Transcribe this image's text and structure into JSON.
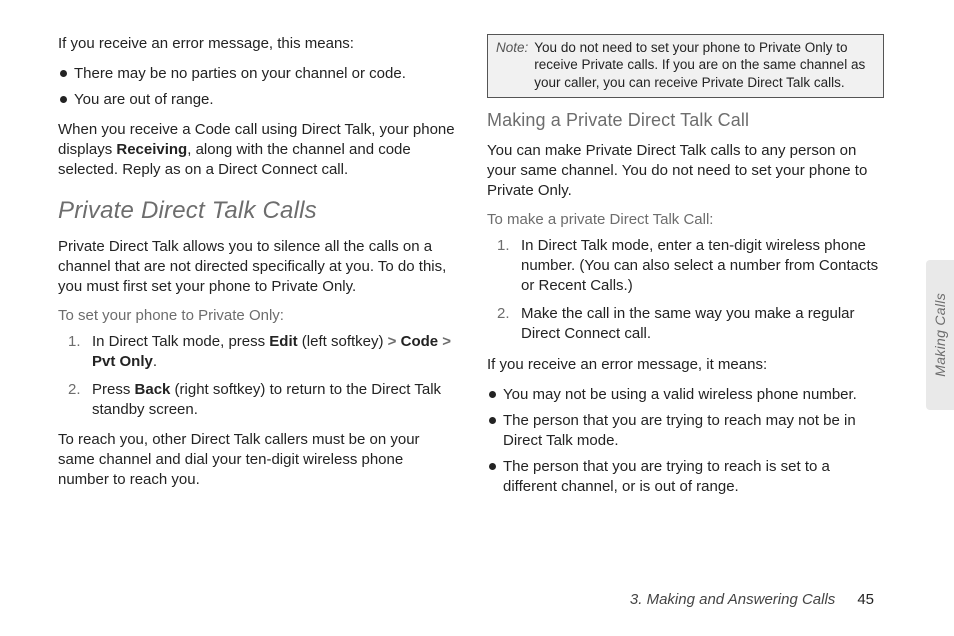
{
  "left": {
    "p1": "If you receive an error message, this means:",
    "bullets1": [
      "There may be no parties on your channel or code.",
      "You are out of range."
    ],
    "p2a": "When you receive a Code call using Direct Talk, your phone displays ",
    "p2bold": "Receiving",
    "p2b": ", along with the channel and code selected. Reply as on a Direct Connect call.",
    "h2": "Private Direct Talk Calls",
    "p3": "Private Direct Talk allows you to silence all the calls on a channel that are not directed specifically at you. To do this, you must first set your phone to Private Only.",
    "lead1": "To set your phone to Private Only:",
    "step1a": "In Direct Talk mode, press ",
    "step1b_bold": "Edit",
    "step1c": " (left softkey) ",
    "step1_gt1": ">",
    "step1d_bold": "Code",
    "step1_gt2": ">",
    "step1e_bold": "Pvt Only",
    "step1f": ".",
    "step2a": "Press ",
    "step2b_bold": "Back",
    "step2c": " (right softkey) to return to the Direct Talk standby screen.",
    "p4": "To reach you, other Direct Talk callers must be on your same channel and dial your ten-digit wireless phone number to reach you."
  },
  "right": {
    "note_label": "Note:",
    "note_body": "You do not need to set your phone to Private Only to receive Private calls. If you are on the same channel as your caller, you can receive Private Direct Talk calls.",
    "h3": "Making a Private Direct Talk Call",
    "p1": "You can make Private Direct Talk calls to any person on your same channel. You do not need to set your phone to Private Only.",
    "lead1": "To make a private Direct Talk Call:",
    "step1": "In Direct Talk mode, enter a ten-digit wireless phone number. (You can also select a number from Contacts or Recent Calls.)",
    "step2": "Make the call in the same way you make a regular Direct Connect call.",
    "p2": "If you receive an error message, it means:",
    "bullets": [
      "You may not be using a valid wireless phone number.",
      "The person that you are trying to reach may not be in Direct Talk mode.",
      "The person that you are trying to reach is set to a different channel, or is out of range."
    ]
  },
  "sidetab": "Making Calls",
  "footer": {
    "section": "3. Making and Answering Calls",
    "page": "45"
  }
}
